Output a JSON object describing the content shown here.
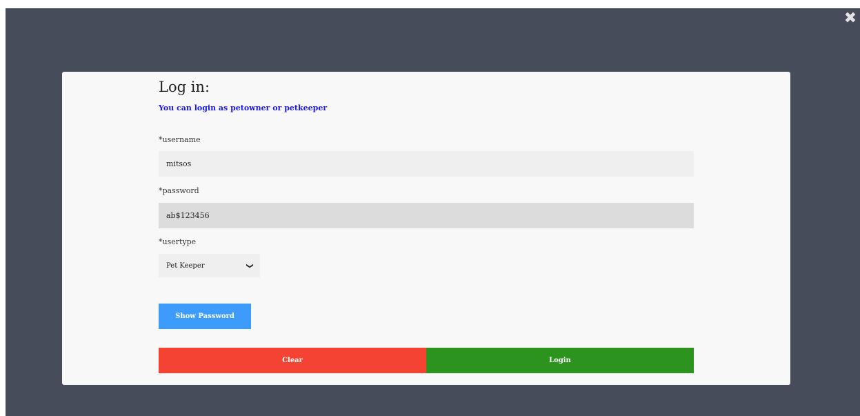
{
  "overlay": {
    "close_symbol": "✖"
  },
  "login_form": {
    "title": "Log in:",
    "subtitle": "You can login as petowner or petkeeper",
    "username_label": "*username",
    "username_value": "mitsos",
    "password_label": "*password",
    "password_value": "ab$123456",
    "usertype_label": "*usertype",
    "usertype_selected": "Pet Keeper",
    "show_password_label": "Show Password",
    "clear_label": "Clear",
    "login_label": "Login"
  },
  "colors": {
    "overlay_bg": "#474c5a",
    "subtitle_text": "#1a1aef",
    "show_password_button": "#3c9bfb",
    "clear_button": "#f44333",
    "login_button": "#2b931e"
  }
}
